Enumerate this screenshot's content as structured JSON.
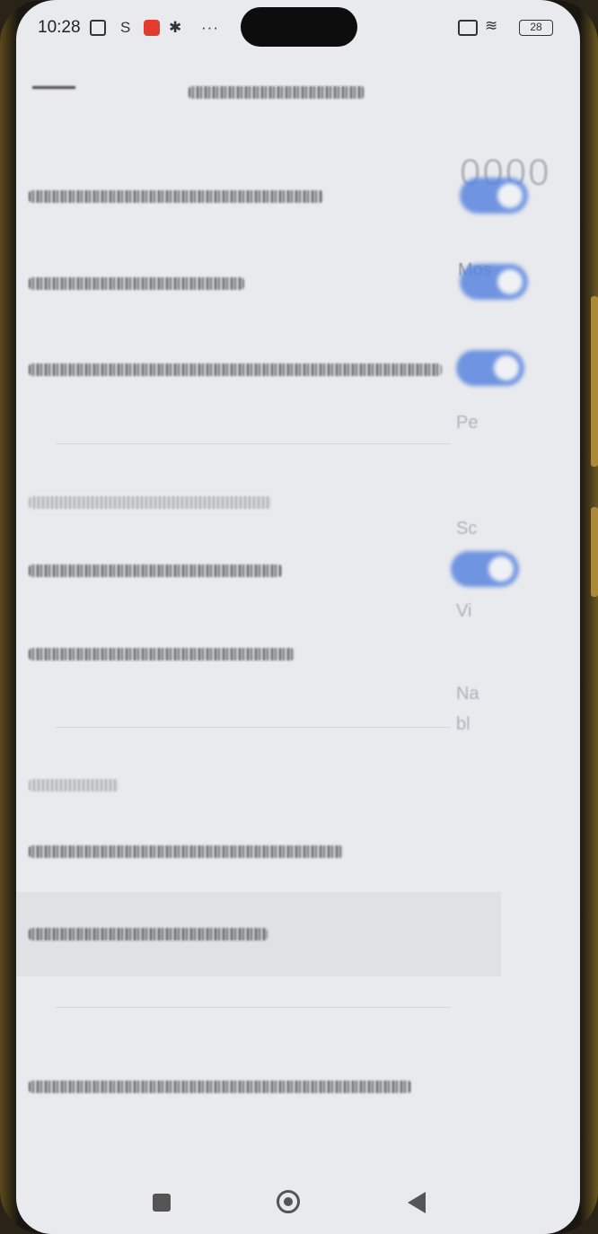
{
  "status_bar": {
    "time": "10:28",
    "icons": [
      "nfc-icon",
      "s-icon",
      "mail-icon",
      "gear-icon",
      "more-icon",
      "no-sim-icon",
      "wifi-icon",
      "battery-icon"
    ],
    "more_glyph": "···",
    "s_glyph": "S",
    "gear_glyph": "✱",
    "wifi_glyph": "≋",
    "battery_level": "28"
  },
  "settings": {
    "toggles": [
      {
        "name": "toggle-1",
        "state": "on"
      },
      {
        "name": "toggle-2",
        "state": "on"
      },
      {
        "name": "toggle-3",
        "state": "on"
      },
      {
        "name": "toggle-4",
        "state": "on"
      }
    ]
  },
  "ghost_overlay": {
    "line_1": "0000",
    "line_2": "Mos",
    "line_3": "Pe",
    "line_4": "Sc",
    "line_5": "Vi",
    "line_6": "Na",
    "line_7": "bl"
  },
  "colors": {
    "accent": "#5b86e0",
    "screen_bg": "#e8eaed",
    "notification": "#e23b2f"
  },
  "nav_bar": {
    "buttons": [
      "recents-button",
      "home-button",
      "back-button"
    ]
  }
}
